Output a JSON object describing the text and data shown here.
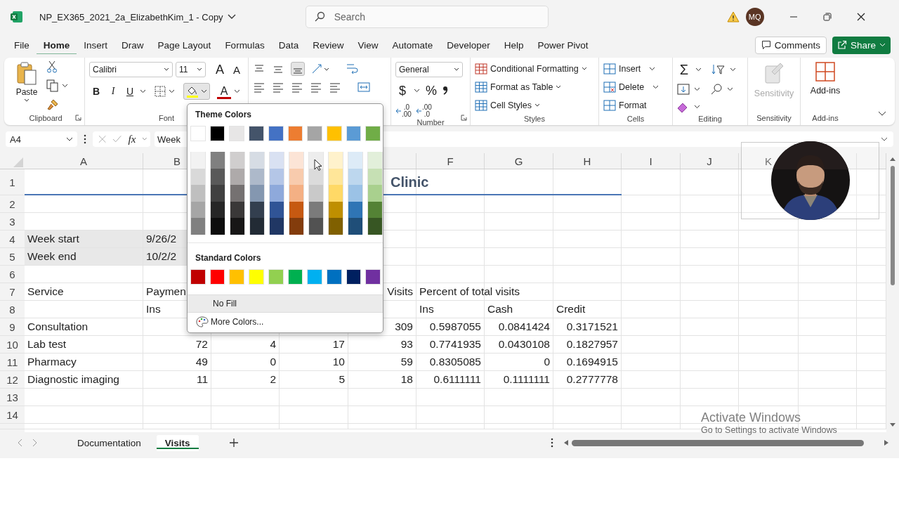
{
  "window": {
    "title": "NP_EX365_2021_2a_ElizabethKim_1 - Copy",
    "search_placeholder": "Search",
    "avatar": "MQ"
  },
  "menu_tabs": [
    {
      "label": "File",
      "selected": false
    },
    {
      "label": "Home",
      "selected": true
    },
    {
      "label": "Insert",
      "selected": false
    },
    {
      "label": "Draw",
      "selected": false
    },
    {
      "label": "Page Layout",
      "selected": false
    },
    {
      "label": "Formulas",
      "selected": false
    },
    {
      "label": "Data",
      "selected": false
    },
    {
      "label": "Review",
      "selected": false
    },
    {
      "label": "View",
      "selected": false
    },
    {
      "label": "Automate",
      "selected": false
    },
    {
      "label": "Developer",
      "selected": false
    },
    {
      "label": "Help",
      "selected": false
    },
    {
      "label": "Power Pivot",
      "selected": false
    }
  ],
  "comments_button": "Comments",
  "share_button": "Share",
  "ribbon": {
    "clipboard": {
      "label": "Clipboard",
      "paste": "Paste"
    },
    "font": {
      "label": "Font",
      "family": "Calibri",
      "size": "11",
      "grow": "A",
      "shrink": "A",
      "bold": "B",
      "italic": "I",
      "underline": "U",
      "font_color": "A"
    },
    "number": {
      "label": "Number",
      "format": "General",
      "currency": "$",
      "percent": "%",
      "decimals": [
        {
          "top": ".0",
          "bottom": ".00"
        },
        {
          "top": ".00",
          "bottom": ".0"
        }
      ]
    },
    "styles": {
      "label": "Styles",
      "items": [
        "Conditional Formatting",
        "Format as Table",
        "Cell Styles"
      ]
    },
    "cells": {
      "label": "Cells",
      "items": [
        "Insert",
        "Delete",
        "Format"
      ]
    },
    "editing": {
      "label": "Editing",
      "sum": "Σ"
    },
    "sensitivity": {
      "label": "Sensitivity",
      "button": "Sensitivity",
      "disabled": true
    },
    "addins": {
      "label": "Add-ins",
      "button": "Add-ins"
    }
  },
  "formula_bar": {
    "name_box": "A4",
    "fx": "fx",
    "value": "Week"
  },
  "sheet": {
    "columns": {
      "A": "A",
      "B": "B",
      "F": "F",
      "G": "G",
      "H": "H",
      "I": "I",
      "J": "J",
      "K": "K"
    },
    "rows": [
      {
        "number": "1",
        "cells": {
          "E": {
            "text": "Clinic",
            "kind": "title",
            "selected": false
          }
        }
      },
      {
        "number": "2",
        "cells": {}
      },
      {
        "number": "3",
        "cells": {}
      },
      {
        "number": "4",
        "cells": {
          "A": {
            "text": "Week start",
            "kind": "text",
            "selected": true
          },
          "B": {
            "text": "9/26/2",
            "kind": "text",
            "selected": true
          }
        }
      },
      {
        "number": "5",
        "cells": {
          "A": {
            "text": "Week end",
            "kind": "text",
            "selected": true
          },
          "B": {
            "text": "10/2/2",
            "kind": "text",
            "selected": true
          }
        }
      },
      {
        "number": "6",
        "cells": {}
      },
      {
        "number": "7",
        "cells": {
          "A": {
            "text": "Service",
            "kind": "text",
            "selected": false
          },
          "B": {
            "text": "Paymen",
            "kind": "text",
            "selected": false
          },
          "E": {
            "text": "Visits",
            "kind": "number",
            "selected": false
          },
          "F": {
            "text": "Percent of total visits",
            "kind": "text",
            "selected": false
          }
        }
      },
      {
        "number": "8",
        "cells": {
          "B": {
            "text": "Ins",
            "kind": "text",
            "selected": false
          },
          "F": {
            "text": "Ins",
            "kind": "text",
            "selected": false
          },
          "G": {
            "text": "Cash",
            "kind": "text",
            "selected": false
          },
          "H": {
            "text": "Credit",
            "kind": "text",
            "selected": false
          }
        }
      },
      {
        "number": "9",
        "cells": {
          "A": {
            "text": "Consultation",
            "kind": "text",
            "selected": false
          },
          "E": {
            "text": "309",
            "kind": "number",
            "selected": false
          },
          "F": {
            "text": "0.5987055",
            "kind": "number",
            "selected": false
          },
          "G": {
            "text": "0.0841424",
            "kind": "number",
            "selected": false
          },
          "H": {
            "text": "0.3171521",
            "kind": "number",
            "selected": false
          }
        }
      },
      {
        "number": "10",
        "cells": {
          "A": {
            "text": "Lab test",
            "kind": "text",
            "selected": false
          },
          "B": {
            "text": "72",
            "kind": "number",
            "selected": false
          },
          "C": {
            "text": "4",
            "kind": "number",
            "selected": false
          },
          "D": {
            "text": "17",
            "kind": "number",
            "selected": false
          },
          "E": {
            "text": "93",
            "kind": "number",
            "selected": false
          },
          "F": {
            "text": "0.7741935",
            "kind": "number",
            "selected": false
          },
          "G": {
            "text": "0.0430108",
            "kind": "number",
            "selected": false
          },
          "H": {
            "text": "0.1827957",
            "kind": "number",
            "selected": false
          }
        }
      },
      {
        "number": "11",
        "cells": {
          "A": {
            "text": "Pharmacy",
            "kind": "text",
            "selected": false
          },
          "B": {
            "text": "49",
            "kind": "number",
            "selected": false
          },
          "C": {
            "text": "0",
            "kind": "number",
            "selected": false
          },
          "D": {
            "text": "10",
            "kind": "number",
            "selected": false
          },
          "E": {
            "text": "59",
            "kind": "number",
            "selected": false
          },
          "F": {
            "text": "0.8305085",
            "kind": "number",
            "selected": false
          },
          "G": {
            "text": "0",
            "kind": "number",
            "selected": false
          },
          "H": {
            "text": "0.1694915",
            "kind": "number",
            "selected": false
          }
        }
      },
      {
        "number": "12",
        "cells": {
          "A": {
            "text": "Diagnostic imaging",
            "kind": "text",
            "selected": false
          },
          "B": {
            "text": "11",
            "kind": "number",
            "selected": false
          },
          "C": {
            "text": "2",
            "kind": "number",
            "selected": false
          },
          "D": {
            "text": "5",
            "kind": "number",
            "selected": false
          },
          "E": {
            "text": "18",
            "kind": "number",
            "selected": false
          },
          "F": {
            "text": "0.6111111",
            "kind": "number",
            "selected": false
          },
          "G": {
            "text": "0.1111111",
            "kind": "number",
            "selected": false
          },
          "H": {
            "text": "0.2777778",
            "kind": "number",
            "selected": false
          }
        }
      },
      {
        "number": "13",
        "cells": {}
      },
      {
        "number": "14",
        "cells": {}
      }
    ]
  },
  "color_menu": {
    "theme_heading": "Theme Colors",
    "theme_colors": [
      {
        "color": "#ffffff",
        "shades": [
          {
            "color": "#f2f2f2"
          },
          {
            "color": "#d9d9d9"
          },
          {
            "color": "#bfbfbf"
          },
          {
            "color": "#a6a6a6"
          },
          {
            "color": "#808080"
          }
        ]
      },
      {
        "color": "#000000",
        "shades": [
          {
            "color": "#808080"
          },
          {
            "color": "#595959"
          },
          {
            "color": "#404040"
          },
          {
            "color": "#262626"
          },
          {
            "color": "#0d0d0d"
          }
        ]
      },
      {
        "color": "#e7e6e6",
        "shades": [
          {
            "color": "#d0cece"
          },
          {
            "color": "#aeaaaa"
          },
          {
            "color": "#757171"
          },
          {
            "color": "#3a3838"
          },
          {
            "color": "#171616"
          }
        ]
      },
      {
        "color": "#44546a",
        "shades": [
          {
            "color": "#d6dce4"
          },
          {
            "color": "#adb9ca"
          },
          {
            "color": "#8497b0"
          },
          {
            "color": "#333f4f"
          },
          {
            "color": "#222b35"
          }
        ]
      },
      {
        "color": "#4472c4",
        "shades": [
          {
            "color": "#d9e1f2"
          },
          {
            "color": "#b4c6e7"
          },
          {
            "color": "#8ea9db"
          },
          {
            "color": "#305496"
          },
          {
            "color": "#203764"
          }
        ]
      },
      {
        "color": "#ed7d31",
        "shades": [
          {
            "color": "#fce4d6"
          },
          {
            "color": "#f8cbad"
          },
          {
            "color": "#f4b084"
          },
          {
            "color": "#c65911"
          },
          {
            "color": "#833c0c"
          }
        ]
      },
      {
        "color": "#a5a5a5",
        "shades": [
          {
            "color": "#ededed"
          },
          {
            "color": "#dbdbdb"
          },
          {
            "color": "#c9c9c9"
          },
          {
            "color": "#7b7b7b"
          },
          {
            "color": "#525252"
          }
        ]
      },
      {
        "color": "#ffc000",
        "shades": [
          {
            "color": "#fff2cc"
          },
          {
            "color": "#ffe699"
          },
          {
            "color": "#ffd966"
          },
          {
            "color": "#bf8f00"
          },
          {
            "color": "#806000"
          }
        ]
      },
      {
        "color": "#5b9bd5",
        "shades": [
          {
            "color": "#ddebf7"
          },
          {
            "color": "#bdd7ee"
          },
          {
            "color": "#9bc2e6"
          },
          {
            "color": "#2f75b5"
          },
          {
            "color": "#1f4e78"
          }
        ]
      },
      {
        "color": "#70ad47",
        "shades": [
          {
            "color": "#e2efda"
          },
          {
            "color": "#c6e0b4"
          },
          {
            "color": "#a9d08e"
          },
          {
            "color": "#548235"
          },
          {
            "color": "#375623"
          }
        ]
      }
    ],
    "standard_heading": "Standard Colors",
    "standard_colors": [
      {
        "color": "#c00000"
      },
      {
        "color": "#ff0000"
      },
      {
        "color": "#ffc000"
      },
      {
        "color": "#ffff00"
      },
      {
        "color": "#92d050"
      },
      {
        "color": "#00b050"
      },
      {
        "color": "#00b0f0"
      },
      {
        "color": "#0070c0"
      },
      {
        "color": "#002060"
      },
      {
        "color": "#7030a0"
      }
    ],
    "no_fill": "No Fill",
    "more_colors": "More Colors..."
  },
  "sheet_tabs": [
    {
      "label": "Documentation",
      "selected": false
    },
    {
      "label": "Visits",
      "selected": true
    }
  ],
  "activation_notice": {
    "title": "Activate Windows",
    "subtitle": "Go to Settings to activate Windows"
  }
}
